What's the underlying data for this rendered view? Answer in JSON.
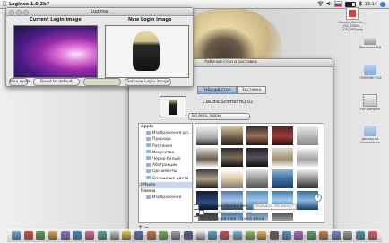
{
  "menubar": {
    "app_name": "Loginox 1.0.2b7",
    "clock": "13:14",
    "status_icons": [
      "wifi-icon",
      "volume-icon",
      "flag-icon",
      "battery-icon",
      "bluetooth-icon",
      "spotlight-icon"
    ]
  },
  "loginox": {
    "title": "Loginox",
    "current_label": "Current Login image",
    "new_label": "New Login image",
    "small_button": "Mini mode",
    "reset_button": "Reset to default",
    "set_button": "Set new Login image"
  },
  "prefs": {
    "title": "Рабочий стол и заставка",
    "tab_desktop": "Рабочий стол",
    "tab_screensaver": "Заставка",
    "image_name": "Claudia.Schiffer.HQ.02",
    "fit_option": "Во весь экран",
    "sources": [
      {
        "label": "Apple",
        "group": true
      },
      {
        "label": "Изображения дл...",
        "group": false
      },
      {
        "label": "Природа",
        "group": false
      },
      {
        "label": "Растения",
        "group": false
      },
      {
        "label": "Искусство",
        "group": false
      },
      {
        "label": "Черно-белый",
        "group": false
      },
      {
        "label": "Абстракции",
        "group": false
      },
      {
        "label": "Орнаменты",
        "group": false
      },
      {
        "label": "Сплошные цвета",
        "group": false
      },
      {
        "label": "iPhoto",
        "group": true
      },
      {
        "label": "Папки",
        "group": true
      },
      {
        "label": "Изображения",
        "group": false
      }
    ],
    "change_image_label": "Менять изображение:",
    "change_interval": "каждые 30 минут",
    "random_order_label": "В случайном порядке",
    "translucent_menu_label": "Полупрозрачная строка меню",
    "add_remove": "+ −",
    "help": "?"
  },
  "desktop_icons": [
    {
      "label": "Claudia_Schiffer_-_HQ_2000s_-_CSI_PEF.jpeg",
      "color": "#c8c8c8"
    },
    {
      "label": "Macintosh HD",
      "color": "#9aa6b3"
    },
    {
      "label": "COMPARE FILE",
      "color": "#9fb8d6"
    },
    {
      "label": "For Software",
      "color": "#9fb8d6"
    },
    {
      "label": "доклад по психологии",
      "color": "#a9c0dd"
    }
  ],
  "dock_colors": [
    "#6fa8e0",
    "#d9473c",
    "#58a34f",
    "#e0a53a",
    "#8c6cc9",
    "#3f86c6",
    "#e05f9a",
    "#47a7a3",
    "#c7c7c7",
    "#f0c33c",
    "#4e6fb0",
    "#d86c2d",
    "#6fb04e",
    "#9c9c9c",
    "#3f5d8e",
    "#e4e4e4",
    "#5ba0d6",
    "#c84a4a",
    "#72b7e8",
    "#8cc04b",
    "#e8b34a",
    "#5a5a5a",
    "#4a8fd0",
    "#b05ec8",
    "#5aa05a",
    "#ce7b44",
    "#6d86c8",
    "#999999",
    "#3ea0b5",
    "#e85a5a"
  ]
}
